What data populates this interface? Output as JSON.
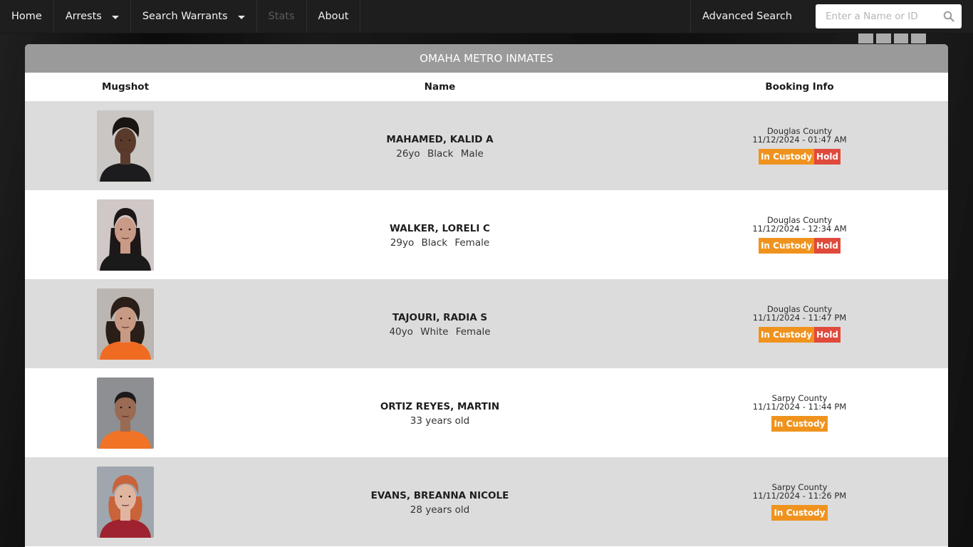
{
  "nav": {
    "items": [
      {
        "label": "Home",
        "dropdown": false,
        "disabled": false
      },
      {
        "label": "Arrests",
        "dropdown": true,
        "disabled": false
      },
      {
        "label": "Search Warrants",
        "dropdown": true,
        "disabled": false
      },
      {
        "label": "Stats",
        "dropdown": false,
        "disabled": true
      },
      {
        "label": "About",
        "dropdown": false,
        "disabled": false
      }
    ],
    "advanced_search": "Advanced Search",
    "search": {
      "placeholder": "Enter a Name or ID",
      "value": "",
      "icon": "search-icon"
    }
  },
  "panel": {
    "title": "OMAHA METRO INMATES",
    "columns": {
      "mugshot": "Mugshot",
      "name": "Name",
      "booking": "Booking Info"
    }
  },
  "colors": {
    "in_custody": "#f0931e",
    "hold": "#e04a3b",
    "header_bg": "#9a9a9a",
    "row_shaded": "#dcdcdc",
    "navbar": "#1e1e1f"
  },
  "inmates": [
    {
      "name": "MAHAMED, KALID A",
      "details": "26yo Black Male",
      "county": "Douglas County",
      "booked": "11/12/2024 - 01:47 AM",
      "badges": [
        "In Custody",
        "Hold"
      ],
      "mugshot": {
        "bg": "#c9c6c3",
        "skin": "#5a3b2b",
        "hair": "#1a1412",
        "shirt": "#1c1c1e"
      }
    },
    {
      "name": "WALKER, LORELI C",
      "details": "29yo Black Female",
      "county": "Douglas County",
      "booked": "11/12/2024 - 12:34 AM",
      "badges": [
        "In Custody",
        "Hold"
      ],
      "mugshot": {
        "bg": "#cfc8c6",
        "skin": "#c99a86",
        "hair": "#1d1717",
        "shirt": "#1a1a1a"
      }
    },
    {
      "name": "TAJOURI, RADIA S",
      "details": "40yo White Female",
      "county": "Douglas County",
      "booked": "11/11/2024 - 11:47 PM",
      "badges": [
        "In Custody",
        "Hold"
      ],
      "mugshot": {
        "bg": "#bcb6b2",
        "skin": "#c89a84",
        "hair": "#2a1e18",
        "shirt": "#ef6b22"
      }
    },
    {
      "name": "ORTIZ REYES, MARTIN",
      "details": "33 years old",
      "county": "Sarpy County",
      "booked": "11/11/2024 - 11:44 PM",
      "badges": [
        "In Custody"
      ],
      "mugshot": {
        "bg": "#8d8f93",
        "skin": "#9a6a52",
        "hair": "#1b1919",
        "shirt": "#f07326"
      }
    },
    {
      "name": "EVANS, BREANNA NICOLE",
      "details": "28 years old",
      "county": "Sarpy County",
      "booked": "11/11/2024 - 11:26 PM",
      "badges": [
        "In Custody"
      ],
      "mugshot": {
        "bg": "#9fa6ad",
        "skin": "#e0b5a0",
        "hair": "#c8633a",
        "shirt": "#9e2230"
      }
    }
  ]
}
